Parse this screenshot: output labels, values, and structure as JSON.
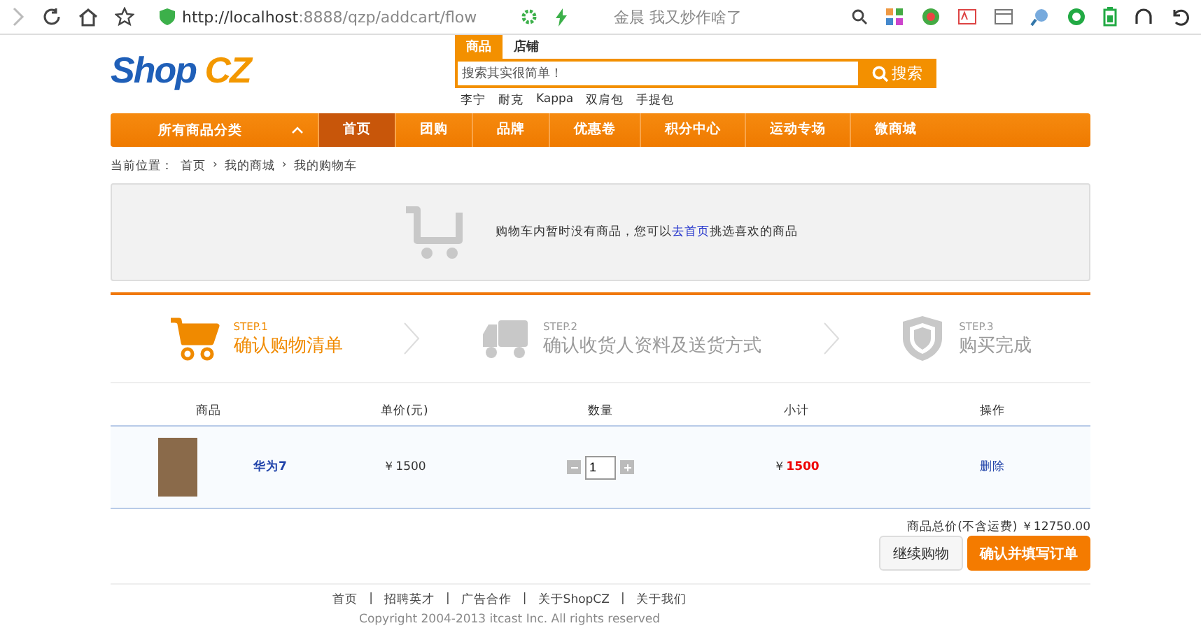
{
  "browser": {
    "url_host": "http://localhost",
    "url_rest": ":8888/qzp/addcart/flow",
    "search_hint": "金晨 我又炒作啥了"
  },
  "header": {
    "logo_main": "Shop",
    "logo_accent": "CZ",
    "search_tabs": [
      {
        "label": "商品",
        "selected": true
      },
      {
        "label": "店铺",
        "selected": false
      }
    ],
    "search_placeholder": "搜索其实很简单！",
    "search_button": "搜索",
    "hot_words": [
      "李宁",
      "耐克",
      "Kappa",
      "双肩包",
      "手提包"
    ]
  },
  "nav": {
    "category_label": "所有商品分类",
    "items": [
      {
        "label": "首页",
        "selected": true
      },
      {
        "label": "团购",
        "selected": false
      },
      {
        "label": "品牌",
        "selected": false
      },
      {
        "label": "优惠卷",
        "selected": false
      },
      {
        "label": "积分中心",
        "selected": false
      },
      {
        "label": "运动专场",
        "selected": false
      },
      {
        "label": "微商城",
        "selected": false
      }
    ]
  },
  "breadcrumb": {
    "label": "当前位置：",
    "separator": "›",
    "items": [
      "首页",
      "我的商城",
      "我的购物车"
    ]
  },
  "empty_cart": {
    "before": "购物车内暂时没有商品，您可以",
    "link": "去首页",
    "after": "挑选喜欢的商品"
  },
  "steps": [
    {
      "kind": "cart",
      "step": "STEP.1",
      "title": "确认购物清单",
      "selected": true
    },
    {
      "kind": "truck",
      "step": "STEP.2",
      "title": "确认收货人资料及送货方式",
      "selected": false
    },
    {
      "kind": "shield",
      "step": "STEP.3",
      "title": "购买完成",
      "selected": false
    }
  ],
  "table": {
    "columns": [
      "商品",
      "单价(元)",
      "数量",
      "小计",
      "操作"
    ],
    "rows": [
      {
        "name": "华为7",
        "price": "￥1500",
        "quantity": "1",
        "subtotal_currency": "￥",
        "subtotal": "1500",
        "action": "删除"
      }
    ]
  },
  "total": "商品总价(不含运费) ￥12750.00",
  "buttons": {
    "continue": "继续购物",
    "confirm": "确认并填写订单"
  },
  "footer": {
    "separator": "|",
    "links": [
      "首页",
      "招聘英才",
      "广告合作",
      "关于ShopCZ",
      "关于我们"
    ],
    "copyright": "Copyright 2004-2013 itcast Inc. All rights reserved"
  }
}
